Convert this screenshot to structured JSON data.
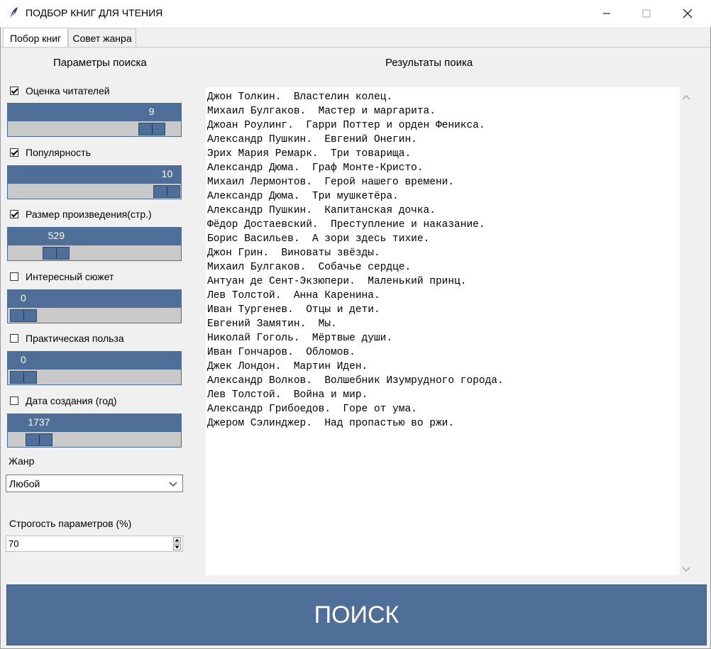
{
  "window": {
    "title": "ПОДБОР КНИГ ДЛЯ ЧТЕНИЯ",
    "app_icon": "feather-icon",
    "controls": [
      "minimize-icon",
      "maximize-icon",
      "close-icon"
    ]
  },
  "tabs": [
    {
      "label": "Побор книг",
      "active": true
    },
    {
      "label": "Совет жанра",
      "active": false
    }
  ],
  "params": {
    "title": "Параметры поиска",
    "items": [
      {
        "label": "Оценка читателей",
        "checked": true,
        "value": "9",
        "fraction": 0.83
      },
      {
        "label": "Популярность",
        "checked": true,
        "value": "10",
        "fraction": 0.92
      },
      {
        "label": "Размер произведения(стр.)",
        "checked": true,
        "value": "529",
        "fraction": 0.28
      },
      {
        "label": "Интересный сюжет",
        "checked": false,
        "value": "0",
        "fraction": 0.09
      },
      {
        "label": "Практическая польза",
        "checked": false,
        "value": "0",
        "fraction": 0.09
      },
      {
        "label": "Дата создания (год)",
        "checked": false,
        "value": "1737",
        "fraction": 0.18
      }
    ],
    "genre_label": "Жанр",
    "genre_value": "Любой",
    "strictness_label": "Строгость параметров (%)",
    "strictness_value": "70"
  },
  "results": {
    "title": "Результаты поика",
    "items": [
      "Джон Толкин.  Властелин колец.",
      "Михаил Булгаков.  Мастер и маргарита.",
      "Джоан Роулинг.  Гарри Поттер и орден Феникса.",
      "Александр Пушкин.  Евгений Онегин.",
      "Эрих Мария Ремарк.  Три товарища.",
      "Александр Дюма.  Граф Монте-Кристо.",
      "Михаил Лермонтов.  Герой нашего времени.",
      "Александр Дюма.  Три мушкетёра.",
      "Александр Пушкин.  Капитанская дочка.",
      "Фёдор Достаевский.  Преступление и наказание.",
      "Борис Васильев.  А зори здесь тихие.",
      "Джон Грин.  Виноваты звёзды.",
      "Михаил Булгаков.  Собачье сердце.",
      "Антуан де Сент-Экзюпери.  Маленький принц.",
      "Лев Толстой.  Анна Каренина.",
      "Иван Тургенев.  Отцы и дети.",
      "Евгений Замятин.  Мы.",
      "Николай Гоголь.  Мёртвые души.",
      "Иван Гончаров.  Обломов.",
      "Джек Лондон.  Мартин Иден.",
      "Александр Волков.  Волшебник Изумрудного города.",
      "Лев Толстой.  Война и мир.",
      "Александр Грибоедов.  Горе от ума.",
      "Джером Сэлинджер.  Над пропастью во ржи."
    ]
  },
  "search_button": "ПОИСК",
  "colors": {
    "accent": "#4f6f98",
    "trough": "#c9c9c9"
  }
}
